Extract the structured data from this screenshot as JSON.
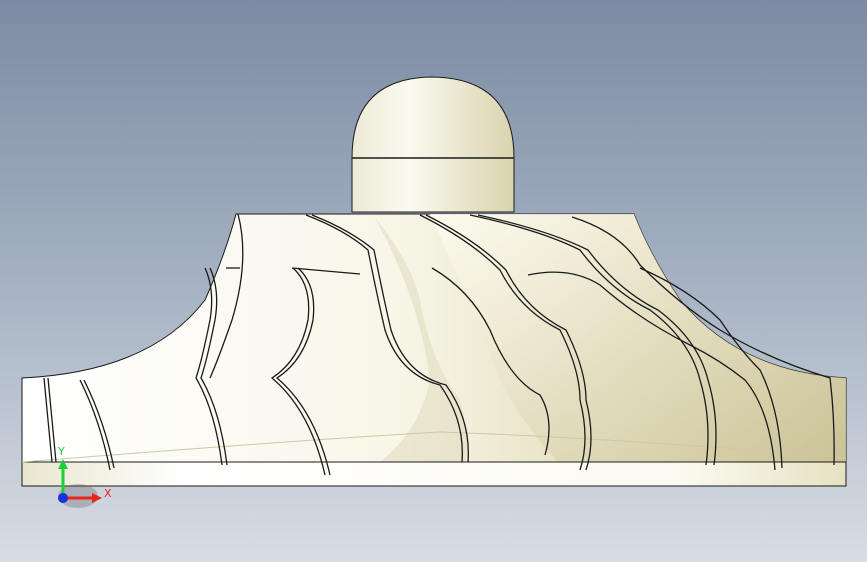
{
  "viewport": {
    "background_top": "#7c8ba3",
    "background_bottom": "#d8dde4"
  },
  "model": {
    "body_color": "#f7f4e4",
    "shade_color": "#d9d2a8",
    "edge_color": "#1a1a1a"
  },
  "triad": {
    "x_label": "X",
    "y_label": "Y",
    "x_color": "#e8241c",
    "y_color": "#1fcf3a",
    "z_color": "#1a2ee0"
  }
}
